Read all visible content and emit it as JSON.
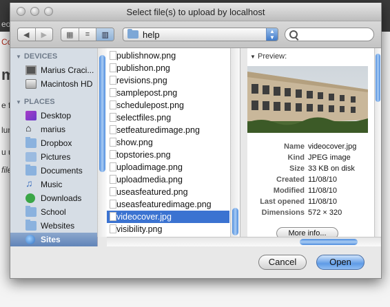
{
  "background_page": {
    "fragments": [
      "eo",
      "Co",
      "m",
      "e fi",
      "lum",
      "u us",
      "file"
    ]
  },
  "dialog": {
    "title": "Select file(s) to upload by localhost",
    "location": "help",
    "view_modes": [
      "icon",
      "list",
      "column"
    ],
    "active_view": "column",
    "search_placeholder": ""
  },
  "sidebar": {
    "devices_header": "DEVICES",
    "places_header": "PLACES",
    "devices": [
      {
        "label": "Marius Craci...",
        "icon": "monitor-icon"
      },
      {
        "label": "Macintosh HD",
        "icon": "hard-drive-icon"
      }
    ],
    "places": [
      {
        "label": "Desktop",
        "icon": "desktop-icon"
      },
      {
        "label": "marius",
        "icon": "home-icon"
      },
      {
        "label": "Dropbox",
        "icon": "folder-icon"
      },
      {
        "label": "Pictures",
        "icon": "pictures-icon"
      },
      {
        "label": "Documents",
        "icon": "folder-icon"
      },
      {
        "label": "Music",
        "icon": "music-icon"
      },
      {
        "label": "Downloads",
        "icon": "downloads-icon"
      },
      {
        "label": "School",
        "icon": "folder-icon"
      },
      {
        "label": "Websites",
        "icon": "folder-icon"
      },
      {
        "label": "Sites",
        "icon": "globe-icon",
        "selected": true
      }
    ]
  },
  "files": [
    "publishnow.png",
    "publishon.png",
    "revisions.png",
    "samplepost.png",
    "schedulepost.png",
    "selectfiles.png",
    "setfeaturedimage.png",
    "show.png",
    "topstories.png",
    "uploadimage.png",
    "uploadmedia.png",
    "useasfeatured.png",
    "useasfeaturedimage.png",
    "videocover.jpg",
    "visibility.png"
  ],
  "selected_file": "videocover.jpg",
  "preview": {
    "header": "Preview:",
    "meta": [
      {
        "key": "Name",
        "value": "videocover.jpg"
      },
      {
        "key": "Kind",
        "value": "JPEG image"
      },
      {
        "key": "Size",
        "value": "33 KB on disk"
      },
      {
        "key": "Created",
        "value": "11/08/10"
      },
      {
        "key": "Modified",
        "value": "11/08/10"
      },
      {
        "key": "Last opened",
        "value": "11/08/10"
      },
      {
        "key": "Dimensions",
        "value": "572 × 320"
      }
    ],
    "more_info_label": "More info..."
  },
  "buttons": {
    "cancel": "Cancel",
    "open": "Open"
  }
}
